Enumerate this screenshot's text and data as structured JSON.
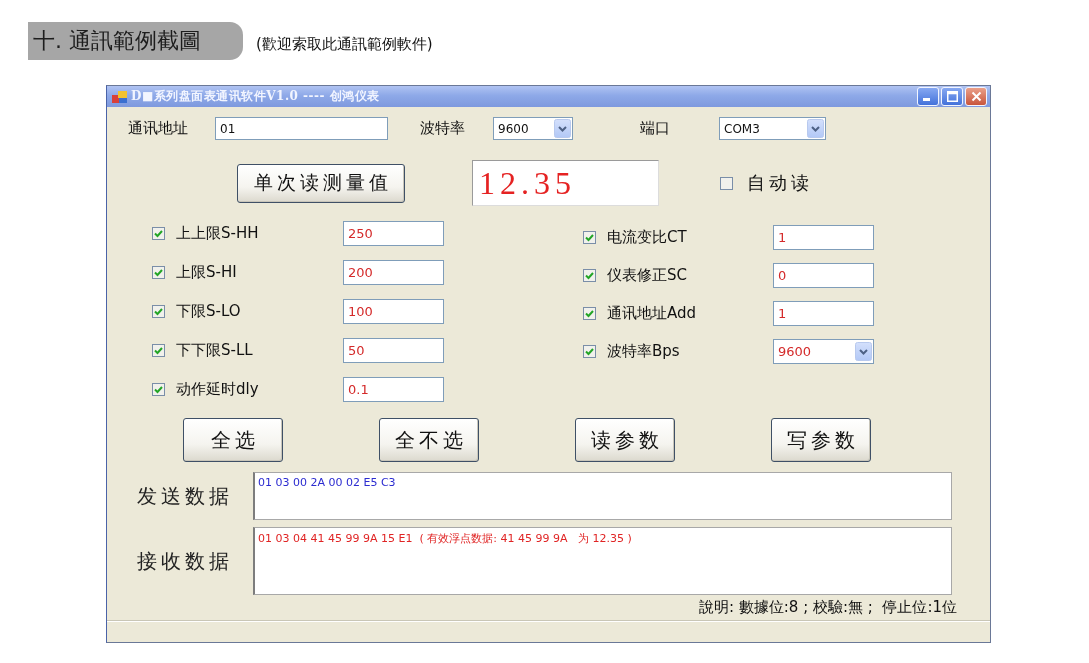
{
  "heading": {
    "title": "十. 通訊範例截圖",
    "subtitle": "(歡迎索取此通訊範例軟件)"
  },
  "window": {
    "title": "D■系列盘面表通讯软件V1.0 ---- 创鸿仪表"
  },
  "connection": [
    {
      "label": "通讯地址",
      "kind": "input",
      "value": "01"
    },
    {
      "label": "波特率",
      "kind": "select",
      "value": "9600"
    },
    {
      "label": "端口",
      "kind": "select",
      "value": "COM3"
    }
  ],
  "measure": {
    "button": "单次读测量值",
    "reading": "12.35",
    "auto_read": {
      "label": "自动读",
      "checked": false
    }
  },
  "params_left": [
    {
      "label": "上上限S-HH",
      "checked": true,
      "kind": "input",
      "value": "250"
    },
    {
      "label": "上限S-HI",
      "checked": true,
      "kind": "input",
      "value": "200"
    },
    {
      "label": "下限S-LO",
      "checked": true,
      "kind": "input",
      "value": "100"
    },
    {
      "label": "下下限S-LL",
      "checked": true,
      "kind": "input",
      "value": "50"
    },
    {
      "label": "动作延时dly",
      "checked": true,
      "kind": "input",
      "value": "0.1"
    }
  ],
  "params_right": [
    {
      "label": "电流变比CT",
      "checked": true,
      "kind": "input",
      "value": "1"
    },
    {
      "label": "仪表修正SC",
      "checked": true,
      "kind": "input",
      "value": "0"
    },
    {
      "label": "通讯地址Add",
      "checked": true,
      "kind": "input",
      "value": "1"
    },
    {
      "label": "波特率Bps",
      "checked": true,
      "kind": "select",
      "value": "9600"
    }
  ],
  "buttons": [
    "全选",
    "全不选",
    "读参数",
    "写参数"
  ],
  "send": {
    "label": "发送数据",
    "text": "01 03 00 2A 00 02 E5 C3"
  },
  "receive": {
    "label": "接收数据",
    "text": "01 03 04 41 45 99 9A 15 E1  ( 有效浮点数据: 41 45 99 9A   为 12.35 )"
  },
  "note": "說明: 數據位:8 ; 校驗:無 ;  停止位:1位"
}
